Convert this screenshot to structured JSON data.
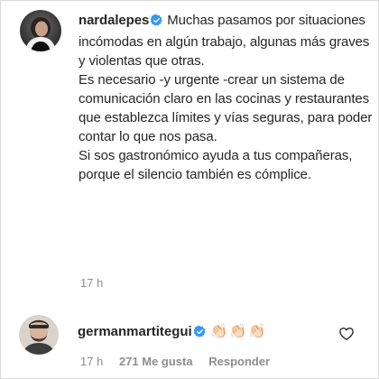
{
  "comments": [
    {
      "username": "nardalepes",
      "verified": true,
      "paragraphs": [
        "Muchas pasamos por situaciones incómodas en algún trabajo, algunas más graves y violentas que otras.",
        "Es necesario -y urgente -crear un sistema de comunicación claro en las cocinas y restaurantes que establezca límites y vías seguras, para poder contar lo que nos pasa.",
        "Si sos gastronómico ayuda a tus compañeras, porque el silencio también es cómplice."
      ],
      "time": "17 h"
    },
    {
      "username": "germanmartitegui",
      "verified": true,
      "text": "👏🏻👏🏻👏🏻",
      "time": "17 h",
      "likes": "271 Me gusta",
      "reply_label": "Responder"
    }
  ],
  "colors": {
    "text": "#262626",
    "muted": "#8e8e8e",
    "verified_badge": "#3897f0"
  },
  "icons": {
    "verified": "verified-badge-icon",
    "like": "heart-outline-icon"
  }
}
